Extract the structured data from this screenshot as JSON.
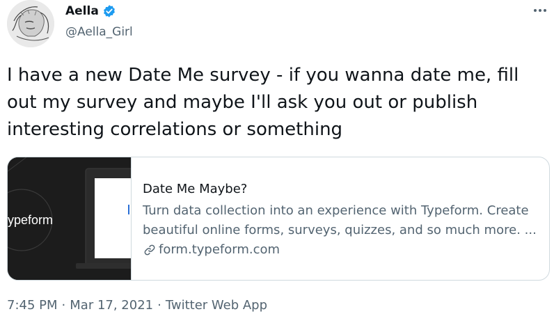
{
  "author": {
    "display_name": "Aella",
    "handle": "@Aella_Girl",
    "verified": true,
    "avatar_icon": "avatar-sketch-portrait"
  },
  "tweet": {
    "text": "I have a new Date Me survey - if you wanna date me, fill\nout my survey and maybe I'll ask you out or publish\ninteresting correlations or something"
  },
  "card": {
    "media_brand": "ypeform",
    "title": "Date Me Maybe?",
    "description_line1": "Turn data collection into an experience with Typeform. Create",
    "description_line2": "beautiful online forms, surveys, quizzes, and so much more. ...",
    "domain": "form.typeform.com"
  },
  "meta": {
    "time": "7:45 PM",
    "separator1": "·",
    "date": "Mar 17, 2021",
    "separator2": "·",
    "source": "Twitter Web App"
  },
  "colors": {
    "verified_blue": "#1d9bf0",
    "secondary_text": "#536471",
    "border": "#cfd9de"
  }
}
